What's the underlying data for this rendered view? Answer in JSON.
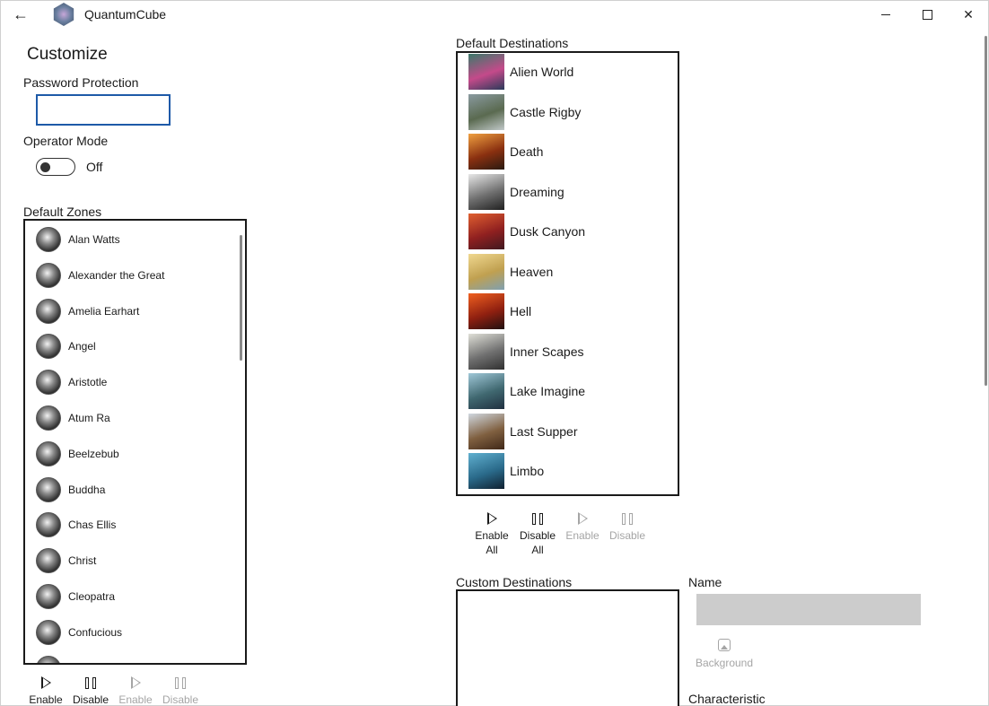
{
  "titlebar": {
    "back_icon": "←",
    "app_title": "QuantumCube",
    "close_icon": "✕"
  },
  "page": {
    "title": "Customize"
  },
  "password": {
    "label": "Password Protection",
    "value": "",
    "placeholder": ""
  },
  "operator_mode": {
    "label": "Operator Mode",
    "state": "Off"
  },
  "zones": {
    "label": "Default Zones",
    "items": [
      {
        "name": "Alan Watts"
      },
      {
        "name": "Alexander the Great"
      },
      {
        "name": "Amelia Earhart"
      },
      {
        "name": "Angel"
      },
      {
        "name": "Aristotle"
      },
      {
        "name": "Atum Ra"
      },
      {
        "name": "Beelzebub"
      },
      {
        "name": "Buddha"
      },
      {
        "name": "Chas Ellis"
      },
      {
        "name": "Christ"
      },
      {
        "name": "Cleopatra"
      },
      {
        "name": "Confucious"
      }
    ],
    "commands": {
      "enable_all": "Enable",
      "disable_all": "Disable",
      "enable": "Enable",
      "disable": "Disable"
    }
  },
  "destinations": {
    "label": "Default Destinations",
    "items": [
      {
        "name": "Alien World",
        "colors": [
          "#3a7a6a",
          "#c44a8a",
          "#2a3a5a"
        ]
      },
      {
        "name": "Castle Rigby",
        "colors": [
          "#8a9aa0",
          "#5a6a50",
          "#c0c8c8"
        ]
      },
      {
        "name": "Death",
        "colors": [
          "#f0a040",
          "#8a3010",
          "#2a1a10"
        ]
      },
      {
        "name": "Dreaming",
        "colors": [
          "#e8e8e8",
          "#707070",
          "#202020"
        ]
      },
      {
        "name": "Dusk Canyon",
        "colors": [
          "#e06030",
          "#902020",
          "#401820"
        ]
      },
      {
        "name": "Heaven",
        "colors": [
          "#f0d890",
          "#c0a050",
          "#80a0b0"
        ]
      },
      {
        "name": "Hell",
        "colors": [
          "#f06020",
          "#902010",
          "#201010"
        ]
      },
      {
        "name": "Inner Scapes",
        "colors": [
          "#e0e0d8",
          "#707070",
          "#303030"
        ]
      },
      {
        "name": "Lake Imagine",
        "colors": [
          "#a0c8d8",
          "#406870",
          "#203040"
        ]
      },
      {
        "name": "Last Supper",
        "colors": [
          "#d0d8e0",
          "#806040",
          "#402818"
        ]
      },
      {
        "name": "Limbo",
        "colors": [
          "#60b0d0",
          "#2a6a8a",
          "#102030"
        ]
      }
    ],
    "commands": {
      "enable_all_1": "Enable",
      "enable_all_2": "All",
      "disable_all_1": "Disable",
      "disable_all_2": "All",
      "enable": "Enable",
      "disable": "Disable"
    }
  },
  "custom_destinations": {
    "label": "Custom Destinations"
  },
  "editor": {
    "name_label": "Name",
    "name_value": "",
    "background_button": "Background",
    "characteristic_label": "Characteristic"
  }
}
